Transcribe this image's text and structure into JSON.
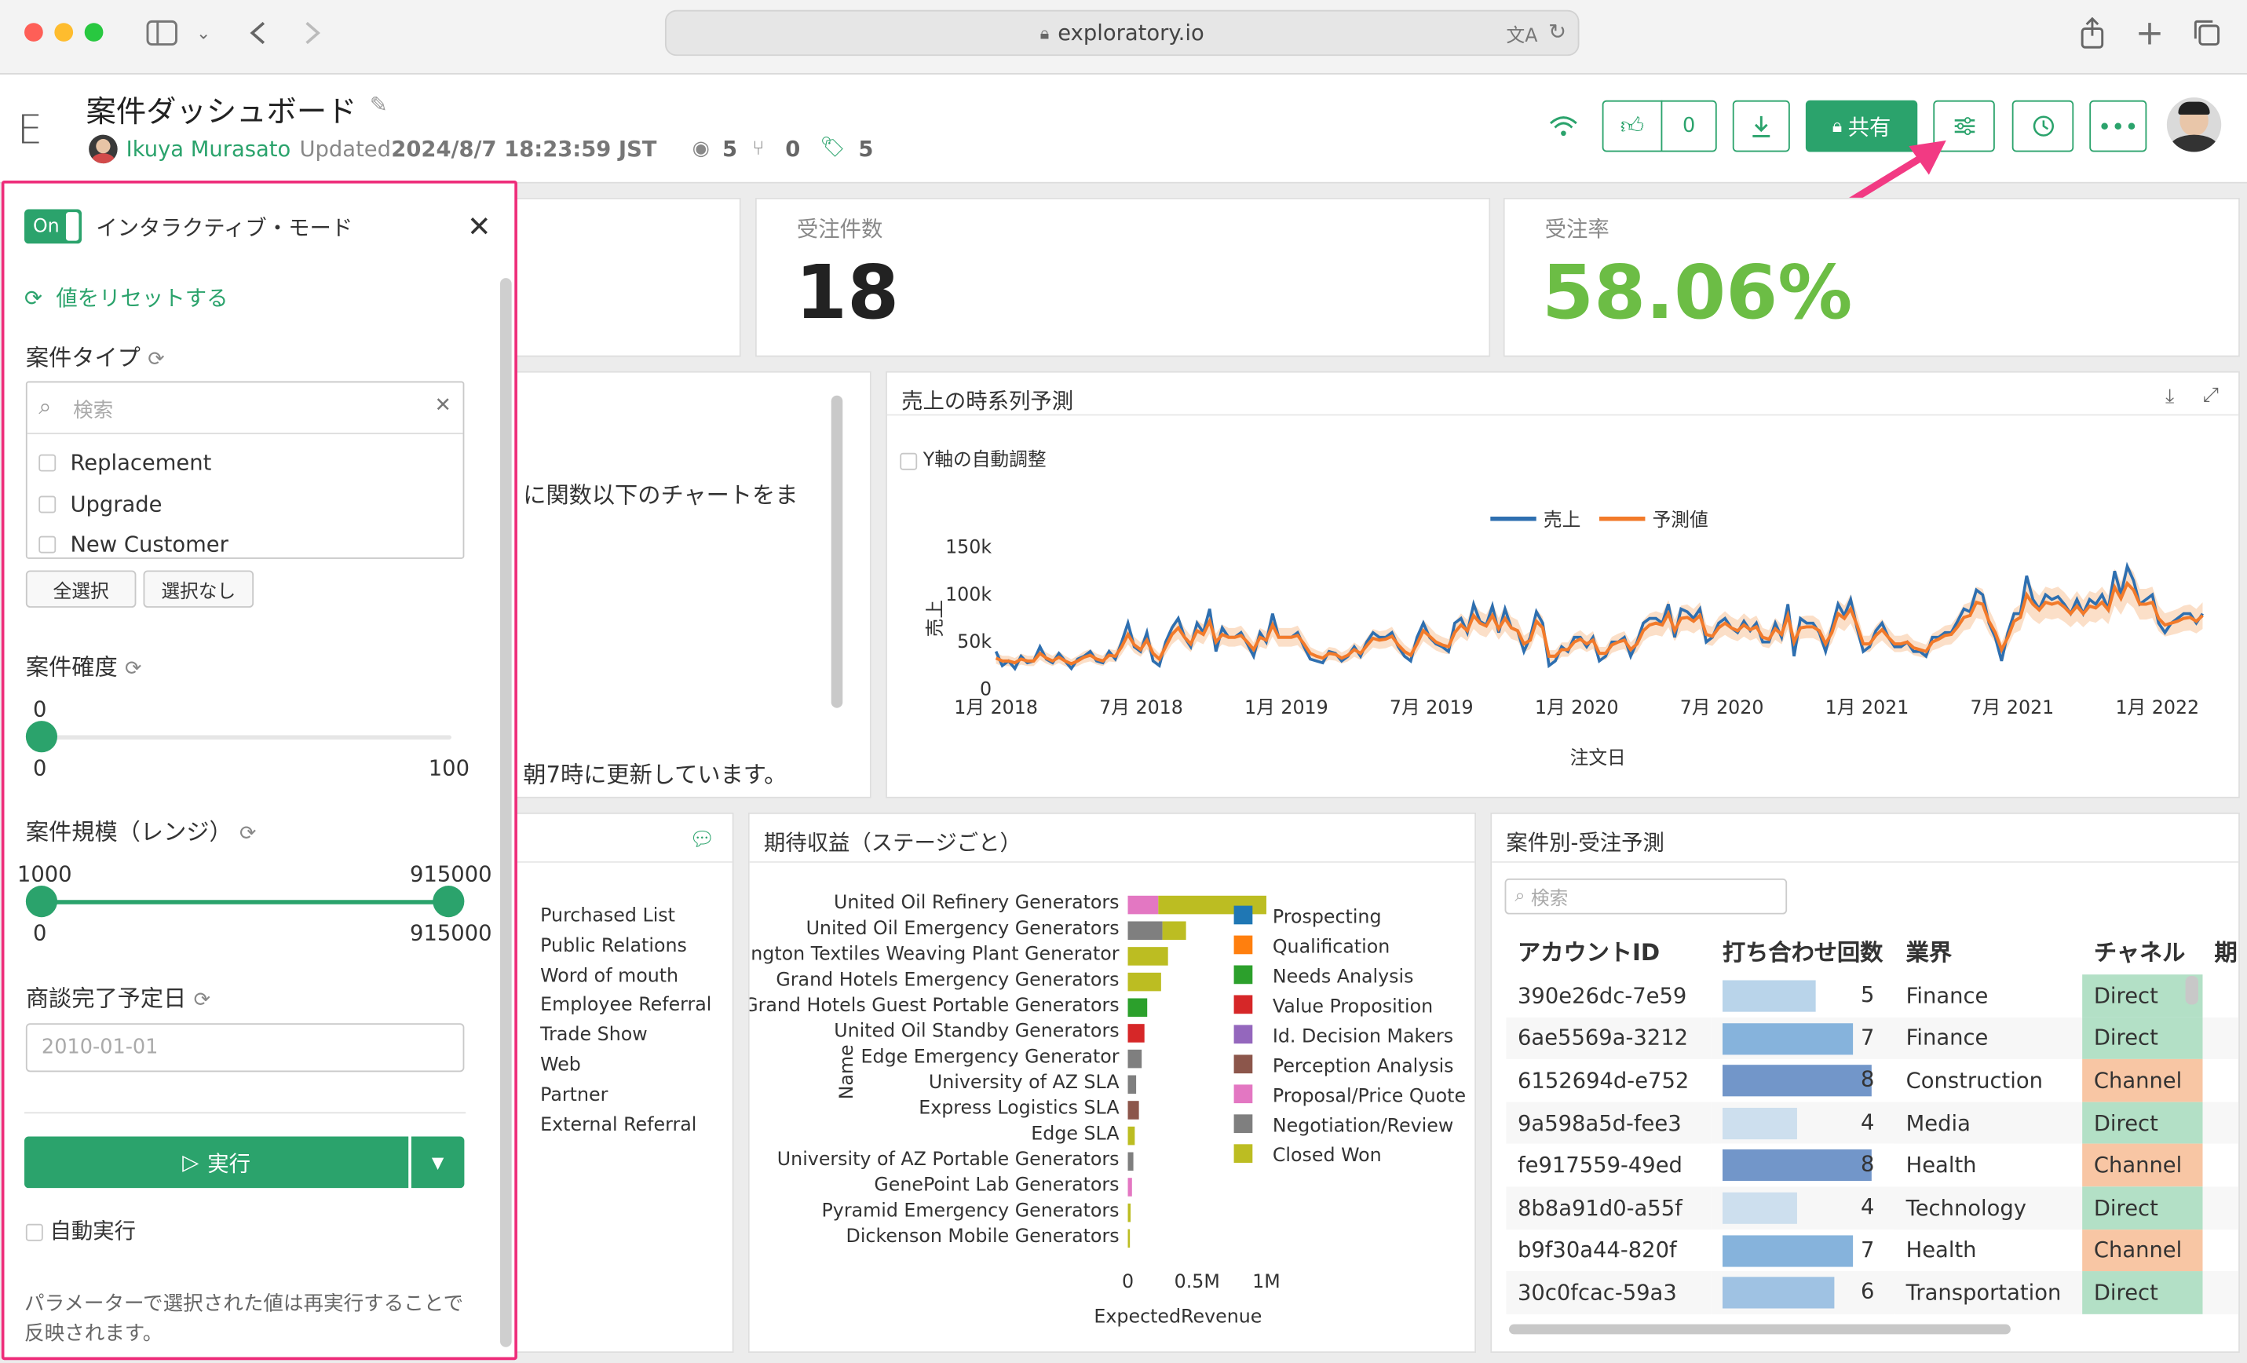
{
  "browser": {
    "url": "exploratory.io"
  },
  "header": {
    "logo": "E",
    "title": "案件ダッシュボード",
    "author": "Ikuya Murasato",
    "updated_label": "Updated",
    "updated_value": "2024/8/7 18:23:59 JST",
    "views": "5",
    "forks": "0",
    "tags": "5",
    "likes": "0",
    "share_label": "共有"
  },
  "panel": {
    "toggle": "On",
    "title": "インタラクティブ・モード",
    "reset": "値をリセットする",
    "type_label": "案件タイプ",
    "search_placeholder": "検索",
    "options": [
      "Replacement",
      "Upgrade",
      "New Customer"
    ],
    "select_all": "全選択",
    "select_none": "選択なし",
    "prob_label": "案件確度",
    "prob_value": "0",
    "prob_min": "0",
    "prob_max": "100",
    "size_label": "案件規模（レンジ）",
    "size_low": "1000",
    "size_high": "915000",
    "size_min": "0",
    "size_max": "915000",
    "date_label": "商談完了予定日",
    "date_placeholder": "2010-01-01",
    "run": "実行",
    "auto_run": "自動実行",
    "note": "パラメーターで選択された値は再実行することで反映されます。"
  },
  "kpi": {
    "orders_label": "受注件数",
    "orders_value": "18",
    "rate_label": "受注率",
    "rate_value": "58.06%",
    "rate_color": "#6cbd45"
  },
  "note_card": {
    "line1": "に関数以下のチャートをま",
    "line2": "朝7時に更新しています。"
  },
  "source_card": {
    "items": [
      "Purchased List",
      "Public Relations",
      "Word of mouth",
      "Employee Referral",
      "Trade Show",
      "Web",
      "Partner",
      "External Referral"
    ]
  },
  "forecast_chart": {
    "title": "売上の時系列予測",
    "auto_y": "Y軸の自動調整"
  },
  "stage_chart": {
    "title": "期待収益（ステージごと）"
  },
  "deal_table": {
    "title": "案件別-受注予測",
    "search_placeholder": "検索",
    "columns": [
      "アカウントID",
      "打ち合わせ回数",
      "業界",
      "チャネル",
      "期"
    ],
    "rows": [
      {
        "id": "390e26dc-7e59",
        "meetings": 5,
        "industry": "Finance",
        "channel": "Direct"
      },
      {
        "id": "6ae5569a-3212",
        "meetings": 7,
        "industry": "Finance",
        "channel": "Direct"
      },
      {
        "id": "6152694d-e752",
        "meetings": 8,
        "industry": "Construction",
        "channel": "Channel"
      },
      {
        "id": "9a598a5d-fee3",
        "meetings": 4,
        "industry": "Media",
        "channel": "Direct"
      },
      {
        "id": "fe917559-49ed",
        "meetings": 8,
        "industry": "Health",
        "channel": "Channel"
      },
      {
        "id": "8b8a91d0-a55f",
        "meetings": 4,
        "industry": "Technology",
        "channel": "Direct"
      },
      {
        "id": "b9f30a44-820f",
        "meetings": 7,
        "industry": "Health",
        "channel": "Channel"
      },
      {
        "id": "30c0fcac-59a3",
        "meetings": 6,
        "industry": "Transportation",
        "channel": "Direct"
      }
    ],
    "channel_colors": {
      "Direct": "#b3e0c6",
      "Channel": "#f8c6a4"
    }
  },
  "chart_data": [
    {
      "type": "line",
      "title": "売上の時系列予測",
      "xlabel": "注文日",
      "ylabel": "売上",
      "x_ticks": [
        "1月 2018",
        "7月 2018",
        "1月 2019",
        "7月 2019",
        "1月 2020",
        "7月 2020",
        "1月 2021",
        "7月 2021",
        "1月 2022"
      ],
      "y_ticks": [
        "0",
        "50k",
        "100k",
        "150k"
      ],
      "ylim": [
        0,
        150000
      ],
      "legend": "top",
      "series": [
        {
          "name": "売上",
          "color": "#2e6fb0",
          "values": [
            40000,
            25000,
            30000,
            22000,
            35000,
            28000,
            30000,
            45000,
            32000,
            28000,
            38000,
            30000,
            22000,
            32000,
            35000,
            40000,
            30000,
            28000,
            40000,
            32000,
            50000,
            70000,
            45000,
            40000,
            60000,
            30000,
            25000,
            50000,
            65000,
            75000,
            55000,
            45000,
            70000,
            60000,
            85000,
            40000,
            65000,
            55000,
            55000,
            60000,
            48000,
            35000,
            60000,
            50000,
            80000,
            55000,
            55000,
            55000,
            60000,
            45000,
            32000,
            30000,
            28000,
            40000,
            38000,
            30000,
            35000,
            45000,
            35000,
            50000,
            60000,
            55000,
            55000,
            60000,
            45000,
            35000,
            30000,
            55000,
            70000,
            55000,
            48000,
            45000,
            40000,
            70000,
            75000,
            60000,
            90000,
            72000,
            68000,
            88000,
            60000,
            85000,
            65000,
            62000,
            40000,
            55000,
            82000,
            70000,
            25000,
            30000,
            45000,
            40000,
            55000,
            55000,
            45000,
            55000,
            30000,
            35000,
            50000,
            50000,
            55000,
            35000,
            50000,
            70000,
            75000,
            75000,
            70000,
            90000,
            55000,
            85000,
            82000,
            75000,
            85000,
            50000,
            55000,
            70000,
            75000,
            65000,
            60000,
            72000,
            62000,
            70000,
            50000,
            50000,
            70000,
            55000,
            90000,
            35000,
            75000,
            70000,
            70000,
            60000,
            40000,
            65000,
            90000,
            78000,
            95000,
            65000,
            40000,
            45000,
            62000,
            70000,
            55000,
            45000,
            45000,
            50000,
            40000,
            40000,
            35000,
            55000,
            55000,
            60000,
            60000,
            72000,
            85000,
            82000,
            105000,
            100000,
            70000,
            55000,
            30000,
            60000,
            80000,
            80000,
            120000,
            95000,
            85000,
            100000,
            95000,
            98000,
            90000,
            80000,
            95000,
            80000,
            95000,
            90000,
            100000,
            85000,
            125000,
            100000,
            130000,
            115000,
            90000,
            95000,
            100000,
            70000,
            60000,
            70000,
            75000,
            80000,
            80000,
            70000,
            80000
          ]
        },
        {
          "name": "予測値",
          "color": "#f27a2a",
          "values": [
            33000,
            30000,
            30000,
            28000,
            32000,
            30000,
            30000,
            38000,
            33000,
            30000,
            34000,
            30000,
            27000,
            30000,
            34000,
            36000,
            32000,
            30000,
            36000,
            35000,
            45000,
            58000,
            47000,
            42000,
            52000,
            38000,
            32000,
            45000,
            58000,
            65000,
            55000,
            48000,
            62000,
            58000,
            72000,
            50000,
            58000,
            55000,
            55000,
            57000,
            50000,
            42000,
            55000,
            52000,
            68000,
            55000,
            55000,
            55000,
            57000,
            48000,
            38000,
            35000,
            33000,
            38000,
            37000,
            33000,
            36000,
            42000,
            38000,
            46000,
            54000,
            52000,
            53000,
            56000,
            47000,
            40000,
            36000,
            48000,
            62000,
            56000,
            50000,
            47000,
            45000,
            60000,
            68000,
            62000,
            78000,
            70000,
            67000,
            78000,
            64000,
            75000,
            65000,
            62000,
            48000,
            52000,
            72000,
            65000,
            35000,
            35000,
            42000,
            42000,
            50000,
            53000,
            48000,
            52000,
            38000,
            38000,
            47000,
            50000,
            52000,
            42000,
            48000,
            62000,
            68000,
            70000,
            68000,
            80000,
            62000,
            75000,
            76000,
            72000,
            78000,
            58000,
            56000,
            65000,
            70000,
            65000,
            62000,
            68000,
            63000,
            66000,
            55000,
            53000,
            64000,
            58000,
            78000,
            50000,
            65000,
            66000,
            66000,
            62000,
            48000,
            60000,
            80000,
            75000,
            85000,
            68000,
            48000,
            48000,
            57000,
            63000,
            55000,
            48000,
            48000,
            50000,
            44000,
            42000,
            40000,
            50000,
            53000,
            57000,
            58000,
            66000,
            76000,
            78000,
            92000,
            90000,
            72000,
            60000,
            42000,
            55000,
            72000,
            76000,
            100000,
            90000,
            84000,
            92000,
            90000,
            92000,
            87000,
            80000,
            88000,
            80000,
            88000,
            86000,
            92000,
            84000,
            108000,
            96000,
            112000,
            105000,
            90000,
            90000,
            92000,
            75000,
            68000,
            70000,
            72000,
            75000,
            76000,
            72000,
            78000
          ]
        }
      ]
    },
    {
      "type": "bar",
      "orientation": "horizontal",
      "stacked": true,
      "title": "期待収益（ステージごと）",
      "xlabel": "ExpectedRevenue",
      "ylabel": "Name",
      "x_ticks": [
        "0",
        "0.5M",
        "1M"
      ],
      "xlim": [
        0,
        1200000
      ],
      "legend": "right",
      "categories": [
        "United Oil Refinery Generators",
        "United Oil Emergency Generators",
        "urlington Textiles Weaving Plant Generator",
        "Grand Hotels Emergency Generators",
        "Grand Hotels Guest Portable Generators",
        "United Oil Standby Generators",
        "Edge Emergency Generator",
        "University of AZ SLA",
        "Express Logistics SLA",
        "Edge SLA",
        "University of AZ Portable Generators",
        "GenePoint Lab Generators",
        "Pyramid Emergency Generators",
        "Dickenson Mobile Generators"
      ],
      "series": [
        {
          "name": "Prospecting",
          "color": "#1f77b4",
          "values": [
            0,
            0,
            0,
            0,
            0,
            0,
            0,
            0,
            0,
            0,
            0,
            0,
            0,
            0
          ]
        },
        {
          "name": "Qualification",
          "color": "#ff7f0e",
          "values": [
            0,
            0,
            0,
            0,
            0,
            0,
            0,
            0,
            0,
            0,
            0,
            0,
            0,
            0
          ]
        },
        {
          "name": "Needs Analysis",
          "color": "#2ca02c",
          "values": [
            0,
            0,
            0,
            0,
            140000,
            0,
            0,
            0,
            0,
            0,
            0,
            0,
            0,
            0
          ]
        },
        {
          "name": "Value Proposition",
          "color": "#d62728",
          "values": [
            0,
            0,
            0,
            0,
            0,
            120000,
            0,
            0,
            0,
            0,
            0,
            0,
            0,
            0
          ]
        },
        {
          "name": "Id. Decision Makers",
          "color": "#9467bd",
          "values": [
            0,
            0,
            0,
            0,
            0,
            0,
            0,
            0,
            0,
            0,
            0,
            0,
            0,
            0
          ]
        },
        {
          "name": "Perception Analysis",
          "color": "#8c564b",
          "values": [
            0,
            0,
            0,
            0,
            0,
            0,
            0,
            0,
            80000,
            0,
            0,
            0,
            0,
            0
          ]
        },
        {
          "name": "Proposal/Price Quote",
          "color": "#e377c2",
          "values": [
            220000,
            0,
            0,
            0,
            0,
            0,
            0,
            0,
            0,
            0,
            0,
            30000,
            0,
            0
          ]
        },
        {
          "name": "Negotiation/Review",
          "color": "#7f7f7f",
          "values": [
            0,
            250000,
            0,
            0,
            0,
            0,
            100000,
            60000,
            0,
            0,
            40000,
            0,
            0,
            0
          ]
        },
        {
          "name": "Closed Won",
          "color": "#bcbd22",
          "values": [
            780000,
            170000,
            290000,
            240000,
            0,
            0,
            0,
            0,
            0,
            50000,
            0,
            0,
            20000,
            15000
          ]
        }
      ]
    }
  ]
}
